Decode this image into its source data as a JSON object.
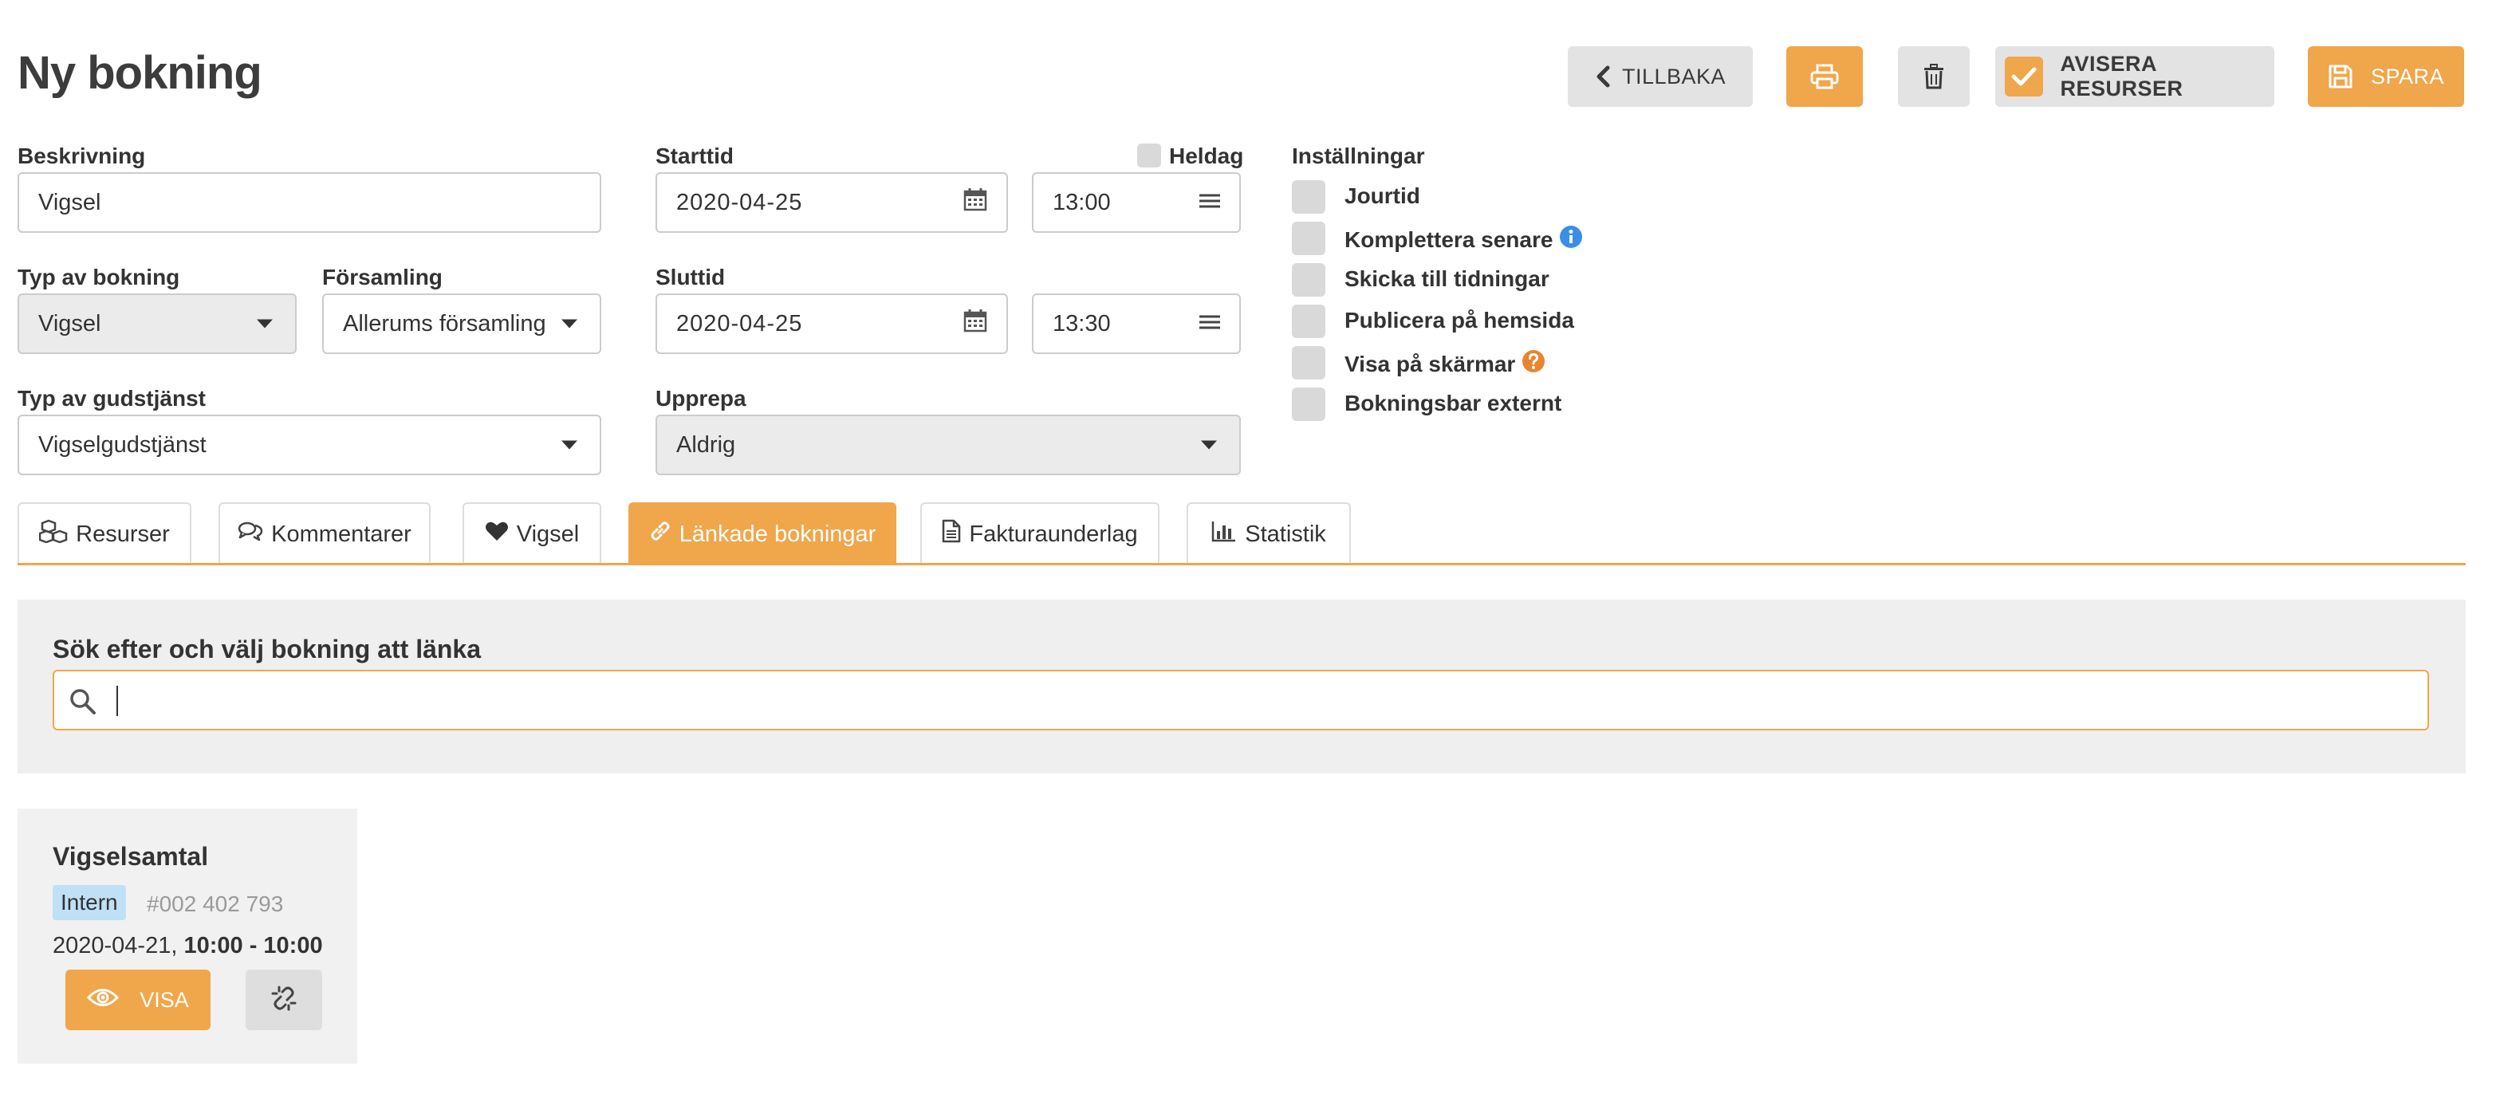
{
  "page": {
    "title": "Ny bokning"
  },
  "header": {
    "back_label": "TILLBAKA",
    "notify_label": "AVISERA RESURSER",
    "save_label": "SPARA"
  },
  "form": {
    "description": {
      "label": "Beskrivning",
      "value": "Vigsel"
    },
    "booking_type": {
      "label": "Typ av bokning",
      "value": "Vigsel"
    },
    "parish": {
      "label": "Församling",
      "value": "Allerums församling"
    },
    "service_type": {
      "label": "Typ av gudstjänst",
      "value": "Vigselgudstjänst"
    },
    "start": {
      "label": "Starttid",
      "date": "2020-04-25",
      "time": "13:00"
    },
    "allday": {
      "label": "Heldag",
      "checked": false
    },
    "end": {
      "label": "Sluttid",
      "date": "2020-04-25",
      "time": "13:30"
    },
    "repeat": {
      "label": "Upprepa",
      "value": "Aldrig"
    }
  },
  "settings": {
    "label": "Inställningar",
    "items": [
      {
        "label": "Jourtid",
        "checked": false
      },
      {
        "label": "Komplettera senare",
        "checked": false,
        "icon": "info-icon"
      },
      {
        "label": "Skicka till tidningar",
        "checked": false
      },
      {
        "label": "Publicera på hemsida",
        "checked": false
      },
      {
        "label": "Visa på skärmar",
        "checked": false,
        "icon": "help-icon"
      },
      {
        "label": "Bokningsbar externt",
        "checked": false
      }
    ]
  },
  "tabs": [
    {
      "label": "Resurser",
      "icon": "cubes-icon",
      "active": false
    },
    {
      "label": "Kommentarer",
      "icon": "comments-icon",
      "active": false
    },
    {
      "label": "Vigsel",
      "icon": "heart-icon",
      "active": false
    },
    {
      "label": "Länkade bokningar",
      "icon": "link-icon",
      "active": true
    },
    {
      "label": "Fakturaunderlag",
      "icon": "document-icon",
      "active": false
    },
    {
      "label": "Statistik",
      "icon": "bar-chart-icon",
      "active": false
    }
  ],
  "search": {
    "label": "Sök efter och välj bokning att länka",
    "value": ""
  },
  "linked_booking": {
    "title": "Vigselsamtal",
    "badge": "Intern",
    "id": "#002 402 793",
    "date": "2020-04-21, ",
    "time": "10:00 - 10:00",
    "view_label": "VISA"
  },
  "colors": {
    "accent": "#f0a64a",
    "badge": "#bfe0f5",
    "info": "#3a8ee6"
  }
}
